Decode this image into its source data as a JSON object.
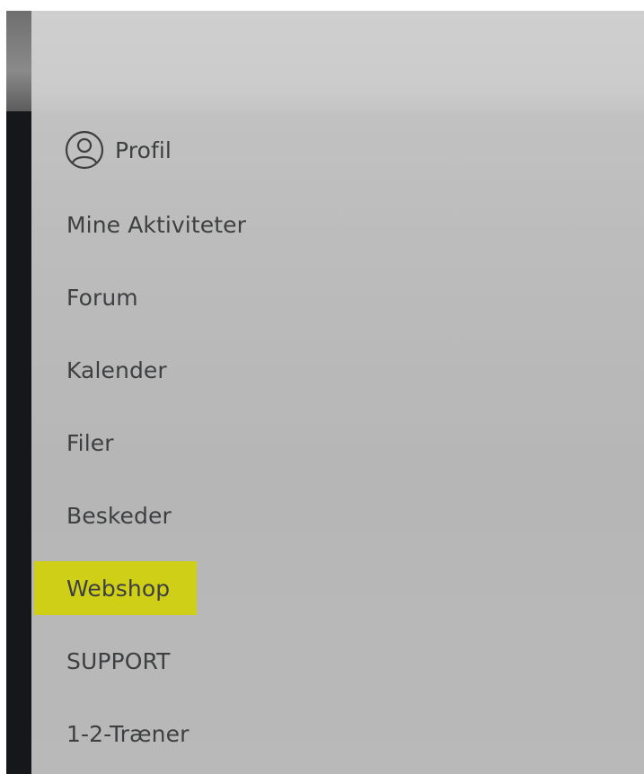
{
  "menu": {
    "items": [
      {
        "label": "Profil",
        "icon": "user-circle-icon"
      },
      {
        "label": "Mine Aktiviteter"
      },
      {
        "label": "Forum"
      },
      {
        "label": "Kalender"
      },
      {
        "label": "Filer"
      },
      {
        "label": "Beskeder"
      },
      {
        "label": "Webshop",
        "highlighted": true
      },
      {
        "label": "SUPPORT"
      },
      {
        "label": "1-2-Træner"
      }
    ]
  },
  "colors": {
    "panel": "#c2c2c2",
    "text": "#3d3f41",
    "highlight": "#d0cf18",
    "left_strip": "#15171b"
  }
}
